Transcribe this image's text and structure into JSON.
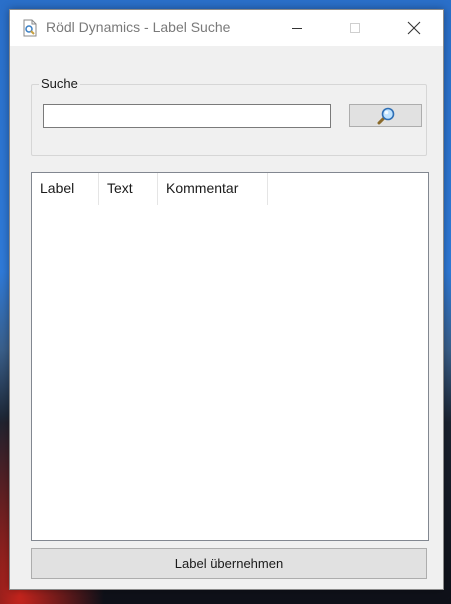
{
  "window": {
    "title": "Rödl Dynamics - Label Suche"
  },
  "search": {
    "group_label": "Suche",
    "input_value": "",
    "button_icon": "search-icon"
  },
  "list": {
    "columns": [
      "Label",
      "Text",
      "Kommentar"
    ],
    "rows": []
  },
  "footer": {
    "accept_label": "Label übernehmen"
  },
  "colors": {
    "window_bg": "#f0f0f0",
    "titlebar_bg": "#ffffff",
    "button_bg": "#e1e1e1"
  }
}
